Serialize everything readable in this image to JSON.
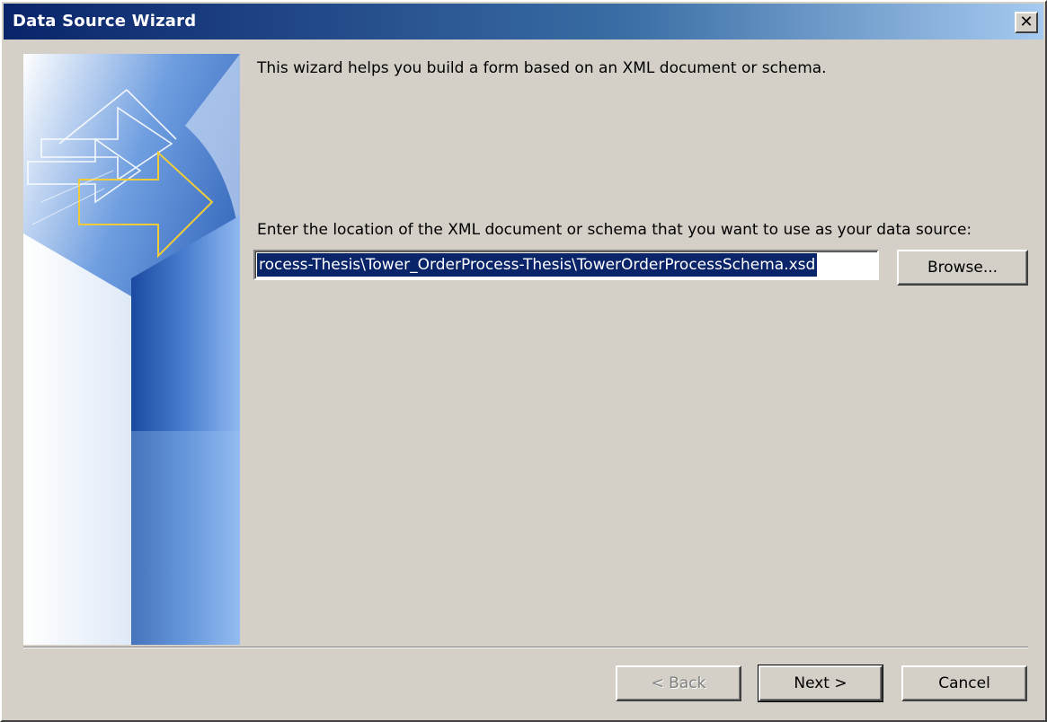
{
  "window": {
    "title": "Data Source Wizard",
    "close_glyph": "✕"
  },
  "banner": {
    "image_name": "wizard-banner-arrows",
    "colors": {
      "dark_blue": "#1e4a9c",
      "mid_blue": "#5c8ed6",
      "light_blue": "#a9c8f0",
      "accent_yellow": "#f0cc3a"
    }
  },
  "main": {
    "intro_text": "This wizard helps you build a form based on an XML document or schema.",
    "prompt_text": "Enter the location of the XML document or schema that you want to use as your data source:",
    "path_value": "rocess-Thesis\\Tower_OrderProcess-Thesis\\TowerOrderProcessSchema.xsd",
    "browse_label": "Browse..."
  },
  "footer": {
    "back_label": "< Back",
    "next_label": "Next >",
    "cancel_label": "Cancel"
  }
}
